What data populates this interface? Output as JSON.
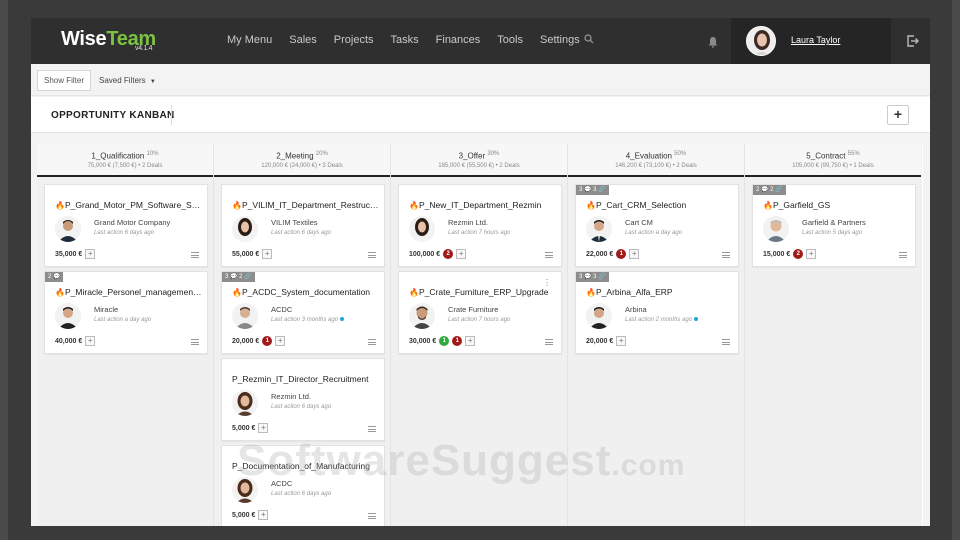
{
  "app": {
    "logo_wise": "Wise",
    "logo_team": "Team",
    "version": "v4.1.4"
  },
  "nav": {
    "items": [
      "My Menu",
      "Sales",
      "Projects",
      "Tasks",
      "Finances",
      "Tools",
      "Settings"
    ],
    "search_icon": "search-icon",
    "bell_icon": "bell-icon"
  },
  "user": {
    "name": "Laura Taylor"
  },
  "filterbar": {
    "show_filter": "Show Filter",
    "saved_filters": "Saved Filters"
  },
  "page": {
    "title": "OPPORTUNITY KANBAN",
    "add_label": "+"
  },
  "columns": [
    {
      "name": "1_Qualification",
      "pct": "10%",
      "summary": "75,000 € (7,500 €) • 2 Deals"
    },
    {
      "name": "2_Meeting",
      "pct": "20%",
      "summary": "120,000 € (24,000 €) • 3 Deals"
    },
    {
      "name": "3_Offer",
      "pct": "30%",
      "summary": "185,000 € (55,500 €) • 2 Deals"
    },
    {
      "name": "4_Evaluation",
      "pct": "50%",
      "summary": "146,200 € (73,100 €) • 2 Deals"
    },
    {
      "name": "5_Contract",
      "pct": "55%",
      "summary": "105,000 € (99,750 €) • 1 Deals"
    }
  ],
  "cards": [
    {
      "tag": "",
      "title": "P_Grand_Motor_PM_Software_Selection",
      "flame": "🔥",
      "flame_color": "#f0a020",
      "company": "Grand Motor Company",
      "last": "Last action 6 days ago",
      "amount": "35,000 €",
      "badges": []
    },
    {
      "tag": "2 💬",
      "title": "P_Miracle_Personel_management_System",
      "flame": "🔥",
      "flame_color": "#2e9bd6",
      "company": "Miracle",
      "last": "Last action a day ago",
      "amount": "40,000 €",
      "badges": []
    },
    {
      "tag": "",
      "title": "P_VILIM_IT_Department_Restructuring",
      "flame": "🔥",
      "flame_color": "#c0281e",
      "company": "VILIM Textiles",
      "last": "Last action 6 days ago",
      "amount": "55,000 €",
      "badges": []
    },
    {
      "tag": "3 💬 2 🔗",
      "title": "P_ACDC_System_documentation",
      "flame": "🔥",
      "flame_color": "#2e9bd6",
      "company": "ACDC",
      "last": "Last action 3 months ago",
      "amount": "20,000 €",
      "badges": [
        "1"
      ]
    },
    {
      "tag": "",
      "title": "P_Rezmin_IT_Director_Recruitment",
      "flame": "",
      "flame_color": "",
      "company": "Rezmin Ltd.",
      "last": "Last action 6 days ago",
      "amount": "5,000 €",
      "badges": []
    },
    {
      "tag": "",
      "title": "P_Documentation_of_Manufacturing",
      "flame": "",
      "flame_color": "",
      "company": "ACDC",
      "last": "Last action 6 days ago",
      "amount": "5,000 €",
      "badges": []
    },
    {
      "tag": "",
      "title": "P_New_IT_Department_Rezmin",
      "flame": "🔥",
      "flame_color": "#c0281e",
      "company": "Rezmin Ltd.",
      "last": "Last action 7 hours ago",
      "amount": "100,000 €",
      "badges": [
        "2"
      ]
    },
    {
      "tag": "",
      "title": "P_Crate_Furniture_ERP_Upgrade",
      "flame": "🔥",
      "flame_color": "#f0a020",
      "company": "Crate Furniture",
      "last": "Last action 7 hours ago",
      "amount": "30,000 €",
      "badges": [
        "1",
        "1"
      ]
    },
    {
      "tag": "3 💬 3 🔗",
      "title": "P_Cart_CRM_Selection",
      "flame": "🔥",
      "flame_color": "#c0281e",
      "company": "Cart CM",
      "last": "Last action a day ago",
      "amount": "22,000 €",
      "badges": [
        "1"
      ]
    },
    {
      "tag": "3 💬 3 🔗",
      "title": "P_Arbina_Alfa_ERP",
      "flame": "🔥",
      "flame_color": "#c0281e",
      "company": "Arbina",
      "last": "Last action 2 months ago",
      "amount": "20,000 €",
      "badges": []
    },
    {
      "tag": "2 💬 2 🔗",
      "title": "P_Garfield_GS",
      "flame": "🔥",
      "flame_color": "#c0281e",
      "company": "Garfield & Partners",
      "last": "Last action 5 days ago",
      "amount": "15,000 €",
      "badges": [
        "2"
      ]
    }
  ],
  "watermark": {
    "main": "SoftwareSuggest",
    "suffix": ".com"
  }
}
